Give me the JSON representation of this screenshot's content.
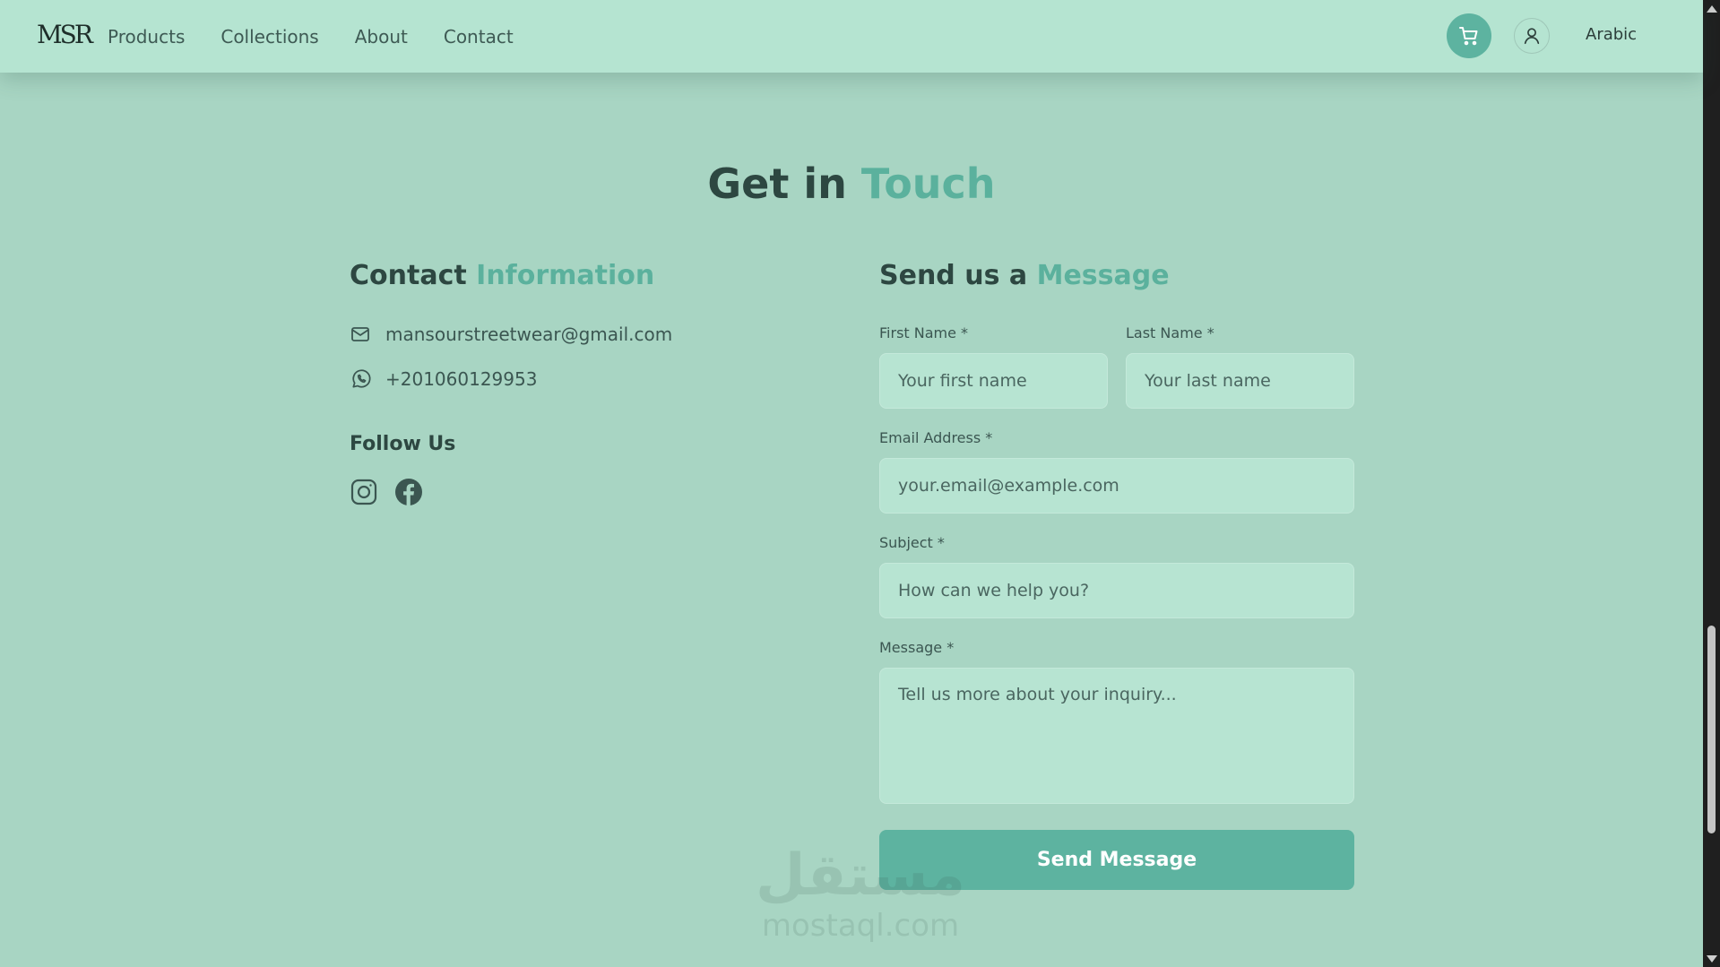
{
  "header": {
    "logo": "MSR",
    "nav": [
      "Products",
      "Collections",
      "About",
      "Contact"
    ],
    "language": "Arabic"
  },
  "hero": {
    "title_main": "Get in",
    "title_accent": "Touch"
  },
  "contact_info": {
    "title_main": "Contact",
    "title_accent": "Information",
    "email": "mansourstreetwear@gmail.com",
    "phone": "+201060129953",
    "follow_title": "Follow Us"
  },
  "form": {
    "title_main": "Send us a",
    "title_accent": "Message",
    "first_name_label": "First Name *",
    "first_name_placeholder": "Your first name",
    "last_name_label": "Last Name *",
    "last_name_placeholder": "Your last name",
    "email_label": "Email Address *",
    "email_placeholder": "your.email@example.com",
    "subject_label": "Subject *",
    "subject_placeholder": "How can we help you?",
    "message_label": "Message *",
    "message_placeholder": "Tell us more about your inquiry...",
    "submit_label": "Send Message"
  },
  "watermark": {
    "arabic": "مستقل",
    "latin": "mostaql.com"
  },
  "colors": {
    "background": "#a8d5c3",
    "header": "#b5e4d1",
    "accent": "#5bb19d",
    "button": "#5db3a0",
    "field": "#b7e4d2"
  }
}
